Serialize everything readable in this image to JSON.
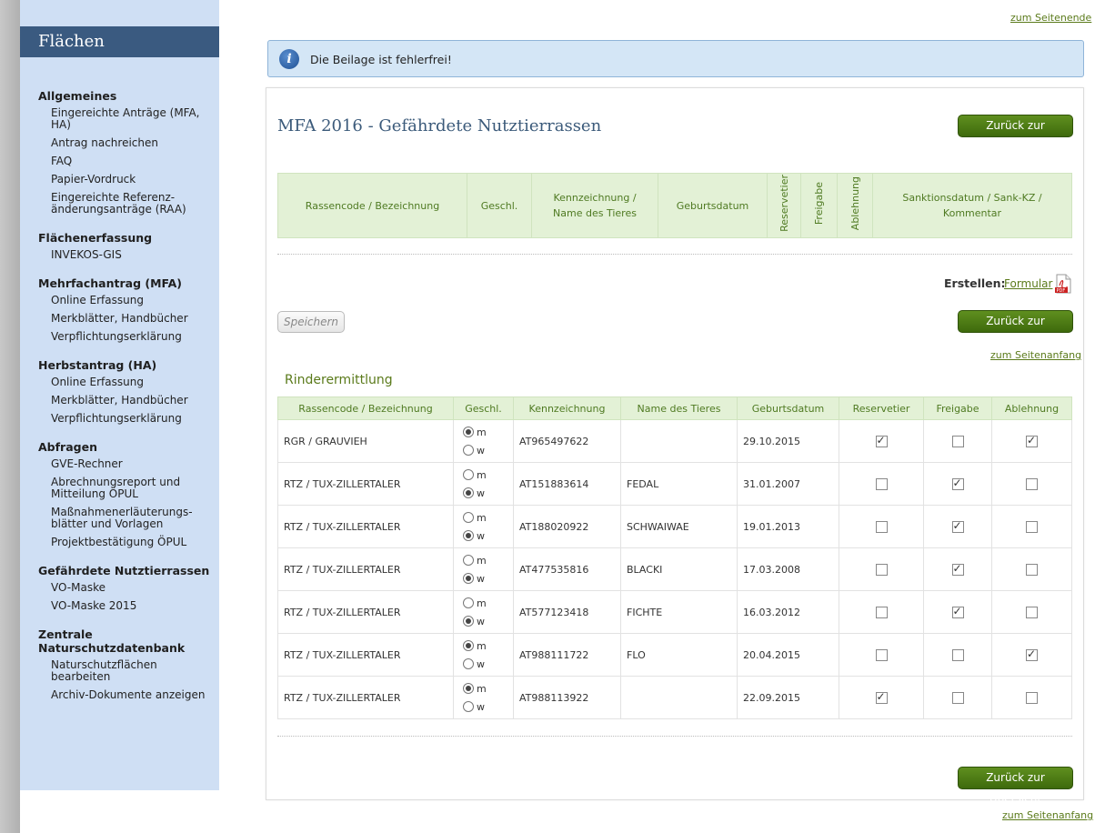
{
  "links": {
    "to_bottom": "zum Seitenende",
    "to_top": "zum Seitenanfang"
  },
  "sidebar": {
    "title": "Flächen",
    "sections": [
      {
        "title": "Allgemeines",
        "items": [
          "Eingereichte Anträge (MFA, HA)",
          "Antrag nachreichen",
          "FAQ",
          "Papier-Vordruck",
          "Eingereichte Referenz-änderungsanträge (RAA)"
        ]
      },
      {
        "title": "Flächenerfassung",
        "items": [
          "INVEKOS-GIS"
        ]
      },
      {
        "title": "Mehrfachantrag (MFA)",
        "items": [
          "Online Erfassung",
          "Merkblätter, Handbücher",
          "Verpflichtungserklärung"
        ]
      },
      {
        "title": "Herbstantrag (HA)",
        "items": [
          "Online Erfassung",
          "Merkblätter, Handbücher",
          "Verpflichtungserklärung"
        ]
      },
      {
        "title": "Abfragen",
        "items": [
          "GVE-Rechner",
          "Abrechnungsreport und Mitteilung ÖPUL",
          "Maßnahmenerläuterungs-blätter und Vorlagen",
          "Projektbestätigung ÖPUL"
        ]
      },
      {
        "title": "Gefährdete Nutztierrassen",
        "items": [
          "VO-Maske",
          "VO-Maske 2015"
        ]
      },
      {
        "title": "Zentrale Naturschutzdatenbank",
        "items": [
          "Naturschutzflächen bearbeiten",
          "Archiv-Dokumente anzeigen"
        ]
      }
    ]
  },
  "info": {
    "message": "Die Beilage ist fehlerfrei!",
    "icon": "info-icon"
  },
  "main": {
    "title": "MFA 2016 - Gefährdete Nutztierrassen",
    "back_button": "Zurück zur Übersicht",
    "save_button": "Speichern",
    "create_label": "Erstellen:",
    "form_link": "Formular",
    "table1_headers": [
      "Rassencode / Bezeichnung",
      "Geschl.",
      "Kennzeichnung / Name des Tieres",
      "Geburtsdatum",
      "Reservetier",
      "Freigabe",
      "Ablehnung",
      "Sanktionsdatum / Sank-KZ / Kommentar"
    ]
  },
  "rinder": {
    "title": "Rinderermittlung",
    "headers": [
      "Rassencode / Bezeichnung",
      "Geschl.",
      "Kennzeichnung",
      "Name des Tieres",
      "Geburtsdatum",
      "Reservetier",
      "Freigabe",
      "Ablehnung"
    ],
    "sex_m": "m",
    "sex_w": "w",
    "rows": [
      {
        "breed": "RGR / GRAUVIEH",
        "sex": "m",
        "id": "AT965497622",
        "name": "",
        "birth": "29.10.2015",
        "reserve": true,
        "release": false,
        "reject": true
      },
      {
        "breed": "RTZ / TUX-ZILLERTALER",
        "sex": "w",
        "id": "AT151883614",
        "name": "FEDAL",
        "birth": "31.01.2007",
        "reserve": false,
        "release": true,
        "reject": false
      },
      {
        "breed": "RTZ / TUX-ZILLERTALER",
        "sex": "w",
        "id": "AT188020922",
        "name": "SCHWAIWAE",
        "birth": "19.01.2013",
        "reserve": false,
        "release": true,
        "reject": false
      },
      {
        "breed": "RTZ / TUX-ZILLERTALER",
        "sex": "w",
        "id": "AT477535816",
        "name": "BLACKI",
        "birth": "17.03.2008",
        "reserve": false,
        "release": true,
        "reject": false
      },
      {
        "breed": "RTZ / TUX-ZILLERTALER",
        "sex": "w",
        "id": "AT577123418",
        "name": "FICHTE",
        "birth": "16.03.2012",
        "reserve": false,
        "release": true,
        "reject": false
      },
      {
        "breed": "RTZ / TUX-ZILLERTALER",
        "sex": "m",
        "id": "AT988111722",
        "name": "FLO",
        "birth": "20.04.2015",
        "reserve": false,
        "release": false,
        "reject": true
      },
      {
        "breed": "RTZ / TUX-ZILLERTALER",
        "sex": "m",
        "id": "AT988113922",
        "name": "",
        "birth": "22.09.2015",
        "reserve": true,
        "release": false,
        "reject": false
      }
    ]
  }
}
